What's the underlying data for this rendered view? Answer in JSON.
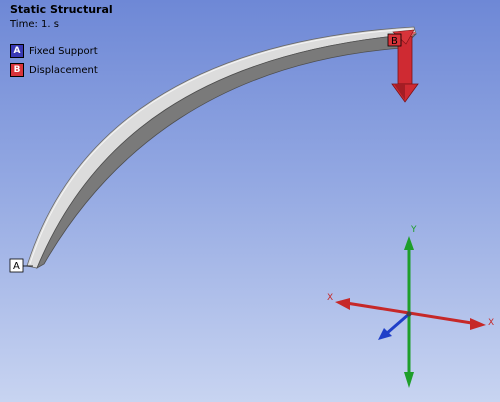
{
  "header": {
    "title": "Static Structural",
    "time": "Time: 1. s"
  },
  "legend": [
    {
      "key": "A",
      "label": "Fixed Support",
      "color": "#3838b4"
    },
    {
      "key": "B",
      "label": "Displacement",
      "color": "#d8343a"
    }
  ],
  "markers": {
    "fixed_support": "A",
    "displacement": "B"
  },
  "triad": {
    "x_label": "X",
    "y_label": "Y",
    "x_color": "#c62828",
    "y_color": "#1e9e2a",
    "z_color": "#1f3fc8"
  },
  "colors": {
    "background_top": "#6e88d6",
    "background_bottom": "#c8d4f1",
    "beam": "#b8b8b8"
  }
}
